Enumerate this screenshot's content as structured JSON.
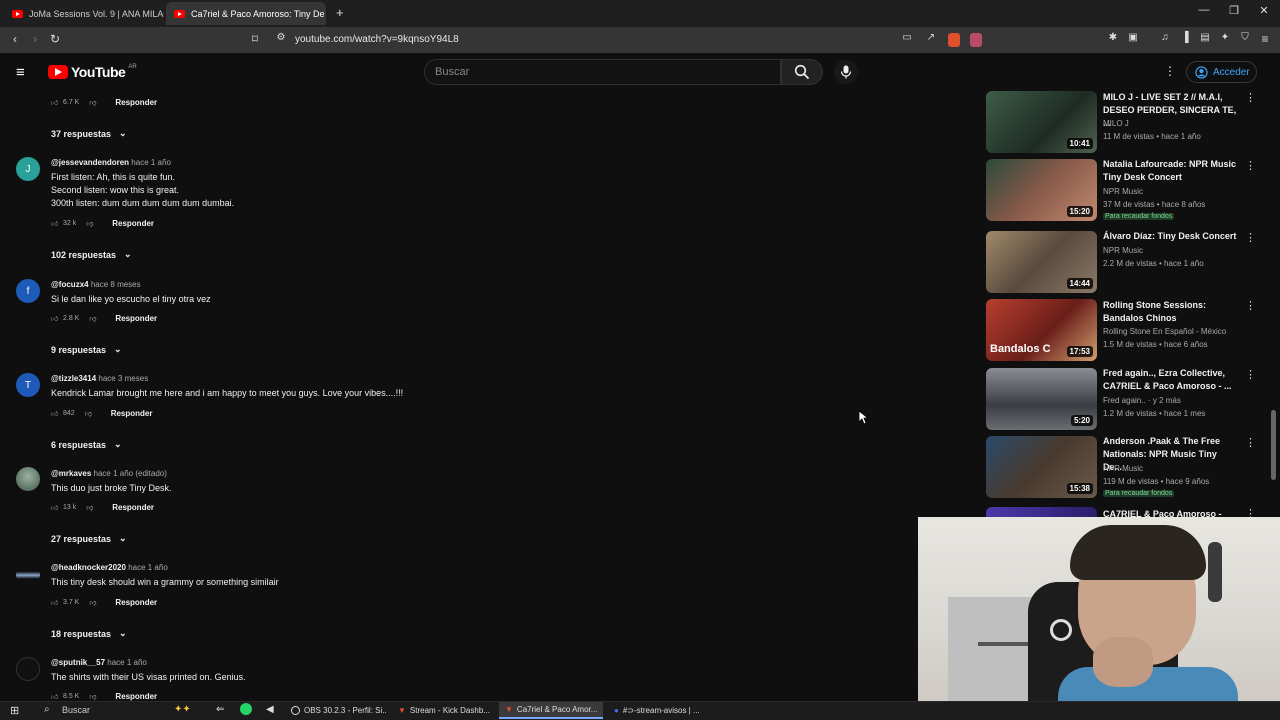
{
  "browser": {
    "tabs": [
      {
        "title": "JoMa Sessions Vol. 9 | ANA MILAGRO"
      },
      {
        "title": "Ca7riel & Paco Amoroso: Tiny De"
      }
    ],
    "new_tab": "+",
    "url": "youtube.com/watch?v=9kqnsoY94L8"
  },
  "youtube": {
    "logo_text": "YouTube",
    "country": "AR",
    "search_placeholder": "Buscar",
    "signin_label": "Acceder"
  },
  "comments": [
    {
      "type": "tail",
      "likes": "6.7 K",
      "reply_label": "Responder",
      "replies": "37 respuestas"
    },
    {
      "avatar_letter": "J",
      "avatar_color": "#2aa198",
      "author": "@jessevandendoren",
      "time": "hace 1 año",
      "lines": [
        "First listen: Ah, this is quite fun.",
        "Second listen: wow this is great.",
        "300th listen: dum dum dum dum dum dumbai."
      ],
      "likes": "32 k",
      "reply_label": "Responder",
      "replies": "102 respuestas"
    },
    {
      "avatar_letter": "f",
      "avatar_color": "#1e5bb8",
      "author": "@focuzx4",
      "time": "hace 8 meses",
      "lines": [
        "Si le dan like yo escucho el tiny otra vez"
      ],
      "likes": "2.8 K",
      "reply_label": "Responder",
      "replies": "9 respuestas"
    },
    {
      "avatar_letter": "T",
      "avatar_color": "#1e5bb8",
      "author": "@tizzle3414",
      "time": "hace 3 meses",
      "lines": [
        "Kendrick Lamar brought me here and i am happy to meet you guys. Love your vibes....!!!"
      ],
      "likes": "842",
      "reply_label": "Responder",
      "replies": "6 respuestas"
    },
    {
      "avatar_letter": "",
      "avatar_color": "#4a6b5a",
      "author": "@mrkaves",
      "time": "hace 1 año (editado)",
      "lines": [
        "This duo just broke Tiny Desk."
      ],
      "likes": "13 k",
      "reply_label": "Responder",
      "replies": "27 respuestas"
    },
    {
      "avatar_letter": "",
      "avatar_color": "#222",
      "author": "@headknocker2020",
      "time": "hace 1 año",
      "lines": [
        "This tiny desk should win a grammy or something similair"
      ],
      "likes": "3.7 K",
      "reply_label": "Responder",
      "replies": "18 respuestas"
    },
    {
      "avatar_letter": "",
      "avatar_color": "#111",
      "author": "@sputnik__57",
      "time": "hace 1 año",
      "lines": [
        "The shirts with their US visas printed on. Genius."
      ],
      "likes": "8.5 K",
      "reply_label": "Responder"
    }
  ],
  "recommendations": [
    {
      "title": "MILO J - LIVE SET 2 // M.A.I, DESEO PERDER, SINCERA TE, ...",
      "channel": "MILO J",
      "meta": "11 M de vistas • hace 1 año",
      "duration": "10:41",
      "color": "#2f4a3a"
    },
    {
      "title": "Natalia Lafourcade: NPR Music Tiny Desk Concert",
      "channel": "NPR Music",
      "meta": "37 M de vistas • hace 8 años",
      "badge": "Para recaudar fondos",
      "duration": "15:20",
      "color": "#6b4a3a"
    },
    {
      "title": "Álvaro Díaz: Tiny Desk Concert",
      "channel": "NPR Music",
      "meta": "2.2 M de vistas • hace 1 año",
      "duration": "14:44",
      "color": "#7a6650"
    },
    {
      "title": "Rolling Stone Sessions: Bandalos Chinos",
      "channel": "Rolling Stone En Español - México",
      "meta": "1.5 M de vistas • hace 6 años",
      "duration": "17:53",
      "color": "#8a2a24",
      "overlay": "Bandalos C"
    },
    {
      "title": "Fred again.., Ezra Collective, CA7RIEL & Paco Amoroso - ...",
      "channel": "Fred again..",
      "channel_extra": "y 2 más",
      "meta": "1.2 M de vistas • hace 1 mes",
      "duration": "5:20",
      "color": "#5a5e62"
    },
    {
      "title": "Anderson .Paak & The Free Nationals: NPR Music Tiny De...",
      "channel": "NPR Music",
      "meta": "119 M de vistas • hace 9 años",
      "badge": "Para recaudar fondos",
      "duration": "15:38",
      "color": "#4a3e36"
    },
    {
      "title": "CA7RIEL & Paco Amoroso -",
      "color": "#3a2e8a"
    }
  ],
  "taskbar": {
    "search": "Buscar",
    "apps": [
      {
        "label": "OBS 30.2.3 - Perfil: Si..."
      },
      {
        "label": "Stream - Kick Dashb..."
      },
      {
        "label": "Ca7riel & Paco Amor..."
      },
      {
        "label": "#⊃-stream-avisos | ..."
      }
    ]
  },
  "icons": [
    "menu-icon",
    "search-icon",
    "mic-icon",
    "user-icon",
    "more-vert-icon",
    "thumb-up-icon",
    "thumb-down-icon",
    "chevron-down-icon"
  ]
}
